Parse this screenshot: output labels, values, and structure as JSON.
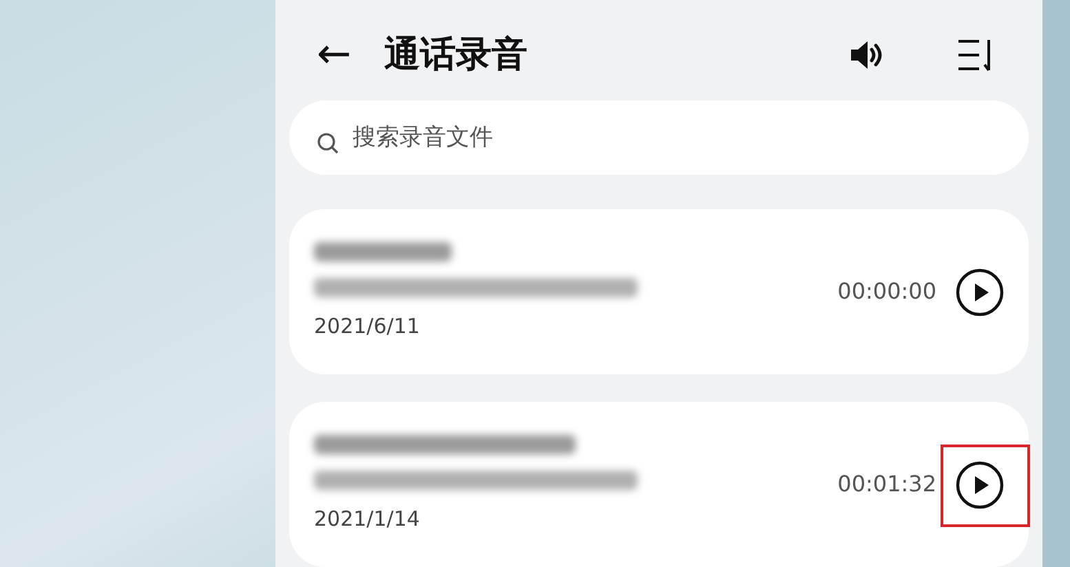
{
  "header": {
    "back": "←",
    "title": "通话录音"
  },
  "search": {
    "placeholder": "搜索录音文件"
  },
  "recordings": [
    {
      "date": "2021/6/11",
      "duration": "00:00:00",
      "highlighted": false
    },
    {
      "date": "2021/1/14",
      "duration": "00:01:32",
      "highlighted": true
    }
  ]
}
